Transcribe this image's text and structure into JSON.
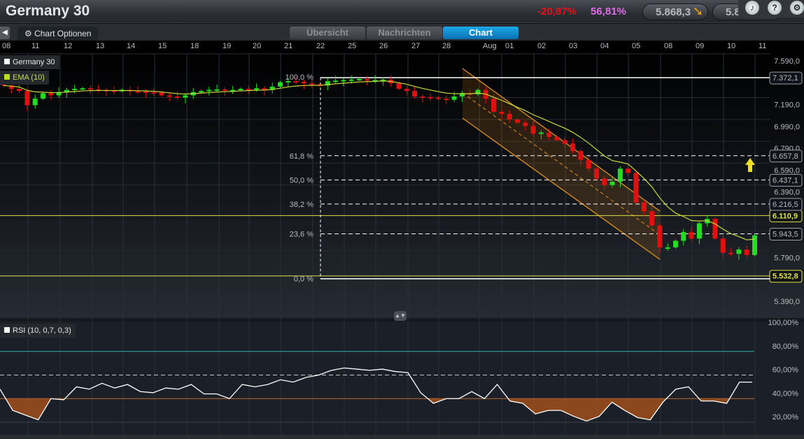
{
  "header": {
    "title": "Germany 30",
    "change_pct": "-20,87%",
    "change2_pct": "56,81%",
    "price1": "5.868,3",
    "price2": "5.8",
    "icons": [
      "sound-icon",
      "help-headset-icon",
      "settings-gears-icon"
    ]
  },
  "toolbar": {
    "chart_options": "Chart Optionen",
    "tabs": [
      {
        "label": "Übersicht",
        "active": false
      },
      {
        "label": "Nachrichten",
        "active": false
      },
      {
        "label": "Chart",
        "active": true
      }
    ]
  },
  "date_axis": [
    "08",
    "11",
    "12",
    "13",
    "14",
    "15",
    "18",
    "19",
    "20",
    "21",
    "22",
    "25",
    "26",
    "27",
    "28",
    "Aug",
    "01",
    "02",
    "03",
    "04",
    "05",
    "08",
    "09",
    "10",
    "11"
  ],
  "legend": {
    "main": "Germany 30",
    "ema": "EMA (10)",
    "rsi": "RSI (10, 0,7, 0,3)"
  },
  "colors": {
    "up": "#22dd22",
    "down": "#e01010",
    "ema": "#c8d840",
    "fib": "#ffffff",
    "level": "#e0e040",
    "channel": "#e09020",
    "rsi_line": "#ffffff",
    "rsi_fill": "#a0501a"
  },
  "chart_data": {
    "type": "candlestick",
    "price_ticks": [
      "7.590,0",
      "7.190,0",
      "6.990,0",
      "6.790,0",
      "6.590,0",
      "6.390,0",
      "5.790,0",
      "5.390,0"
    ],
    "price_tick_values": [
      7590,
      7190,
      6990,
      6790,
      6590,
      6390,
      5790,
      5390
    ],
    "closes": [
      7300,
      7270,
      7250,
      7120,
      7180,
      7230,
      7210,
      7240,
      7260,
      7270,
      7275,
      7265,
      7260,
      7255,
      7250,
      7260,
      7250,
      7245,
      7240,
      7235,
      7210,
      7200,
      7190,
      7210,
      7240,
      7250,
      7260,
      7265,
      7255,
      7260,
      7270,
      7265,
      7275,
      7260,
      7290,
      7330,
      7340,
      7335,
      7320,
      7310,
      7300,
      7340,
      7345,
      7350,
      7355,
      7360,
      7345,
      7350,
      7355,
      7320,
      7270,
      7250,
      7200,
      7195,
      7190,
      7180,
      7170,
      7200,
      7230,
      7220,
      7260,
      7180,
      7060,
      7040,
      6990,
      6960,
      6930,
      6860,
      6870,
      6830,
      6800,
      6770,
      6700,
      6620,
      6540,
      6450,
      6390,
      6420,
      6540,
      6500,
      6230,
      6150,
      6020,
      5820,
      5820,
      5880,
      5960,
      5900,
      6040,
      6080,
      5900,
      5770,
      5760,
      5800,
      5750,
      5930
    ],
    "ema_period": 10,
    "fibonacci": [
      {
        "label": "100,0 %",
        "value": "7.372,1",
        "price": 7372.1
      },
      {
        "label": "61,8 %",
        "value": "6.657,8",
        "price": 6657.8
      },
      {
        "label": "50,0 %",
        "value": "6.437,1",
        "price": 6437.1
      },
      {
        "label": "38,2 %",
        "value": "6.216,5",
        "price": 6216.5
      },
      {
        "label": "23,6 %",
        "value": "5.943,5",
        "price": 5943.5
      },
      {
        "label": "0,0 %",
        "value": "5.532,8",
        "price": 5532.8
      }
    ],
    "levels": [
      {
        "value": "6.110,9",
        "price": 6110.9
      },
      {
        "value": "5.532,8",
        "price": 5532.8
      }
    ],
    "rsi": {
      "ticks": [
        "100,00%",
        "80,00%",
        "60,00%",
        "40,00%",
        "20,00%"
      ],
      "tick_values": [
        100,
        80,
        60,
        40,
        20
      ],
      "upper": 80,
      "mid": 60,
      "lower": 40,
      "values": [
        48,
        30,
        26,
        22,
        40,
        39,
        50,
        48,
        53,
        49,
        52,
        46,
        45,
        49,
        48,
        52,
        44,
        44,
        40,
        52,
        50,
        52,
        56,
        54,
        58,
        60,
        64,
        66,
        65,
        64,
        65,
        63,
        62,
        45,
        36,
        40,
        40,
        46,
        40,
        52,
        38,
        36,
        27,
        30,
        30,
        25,
        21,
        25,
        37,
        30,
        24,
        22,
        37,
        48,
        50,
        38,
        38,
        36,
        54,
        54
      ]
    }
  }
}
